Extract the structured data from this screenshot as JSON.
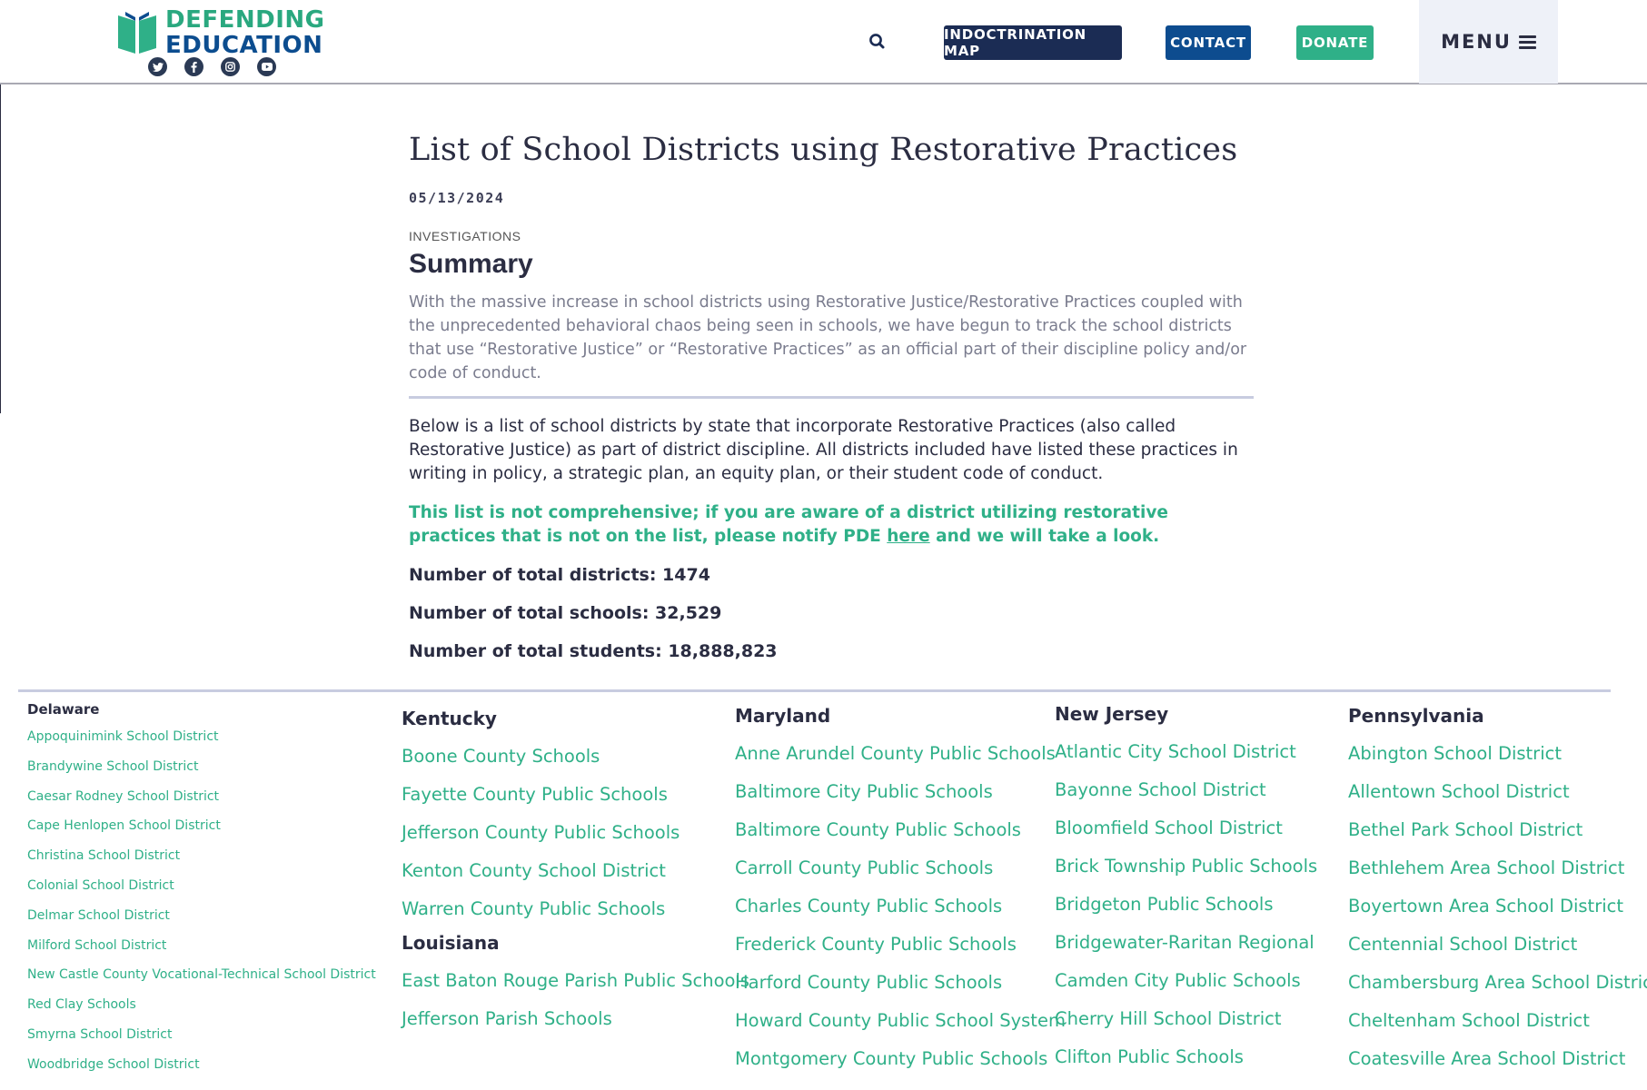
{
  "header": {
    "logo_line1": "DEFENDING",
    "logo_line2": "EDUCATION",
    "socials": [
      "twitter-icon",
      "facebook-icon",
      "instagram-icon",
      "youtube-icon"
    ],
    "search_icon": "search-icon",
    "buttons": {
      "map": "INDOCTRINATION MAP",
      "contact": "CONTACT",
      "donate": "DONATE"
    },
    "menu_label": "MENU",
    "colors": {
      "navy": "#1b2c54",
      "blue": "#0d4c8f",
      "green": "#2fb088"
    }
  },
  "article": {
    "title": "List of School Districts using Restorative Practices",
    "date": "05/13/2024",
    "category": "INVESTIGATIONS",
    "summary_heading": "Summary",
    "summary_text": "With the massive increase in school districts using Restorative Justice/Restorative Practices coupled with the unprecedented behavioral chaos being seen in schools, we have begun to track the school districts that use “Restorative Justice” or “Restorative Practices” as an official part of their discipline policy and/or code of conduct.",
    "body_text": "Below is a list of school districts by state that incorporate Restorative Practices (also called Restorative Justice) as part of district discipline. All districts included have listed these practices in writing in policy, a strategic plan, an equity plan, or their student code of conduct.",
    "notice_before": "This list is not comprehensive; if you are aware of a district utilizing restorative practices that is not on the list, please notify PDE ",
    "notice_link": "here",
    "notice_after": " and we will take a look.",
    "stats": {
      "districts": "Number of total districts: 1474",
      "schools": "Number of total schools: 32,529",
      "students": "Number of total students: 18,888,823"
    }
  },
  "states": {
    "delaware": {
      "name": "Delaware",
      "districts": [
        "Appoquinimink School District",
        "Brandywine School District",
        "Caesar Rodney School District",
        "Cape Henlopen School District",
        "Christina School District",
        "Colonial School District",
        "Delmar School District",
        "Milford School District",
        "New Castle County Vocational-Technical School District",
        "Red Clay Schools",
        "Smyrna School District",
        "Woodbridge School District"
      ]
    },
    "kentucky": {
      "name": "Kentucky",
      "districts": [
        "Boone County Schools",
        "Fayette County Public Schools",
        "Jefferson County Public Schools",
        "Kenton County School District",
        "Warren County Public Schools"
      ]
    },
    "louisiana": {
      "name": "Louisiana",
      "districts": [
        "East Baton Rouge Parish Public Schools",
        "Jefferson Parish Schools"
      ]
    },
    "maryland": {
      "name": "Maryland",
      "districts": [
        "Anne Arundel County Public Schools",
        "Baltimore City Public Schools",
        "Baltimore County Public Schools",
        "Carroll County Public Schools",
        "Charles County Public Schools",
        "Frederick County Public Schools",
        "Harford County Public Schools",
        "Howard County Public School System",
        "Montgomery County Public Schools"
      ]
    },
    "new_jersey": {
      "name": "New Jersey",
      "districts": [
        "Atlantic City School District",
        "Bayonne School District",
        "Bloomfield School District",
        "Brick Township Public Schools",
        "Bridgeton Public Schools",
        "Bridgewater-Raritan Regional",
        "Camden City Public Schools",
        "Cherry Hill School District",
        "Clifton Public Schools"
      ]
    },
    "pennsylvania": {
      "name": "Pennsylvania",
      "districts": [
        "Abington School District",
        "Allentown School District",
        "Bethel Park School District",
        "Bethlehem Area School District",
        "Boyertown Area School District",
        "Centennial School District",
        "Chambersburg Area School District",
        "Cheltenham School District",
        "Coatesville Area School District"
      ]
    }
  }
}
